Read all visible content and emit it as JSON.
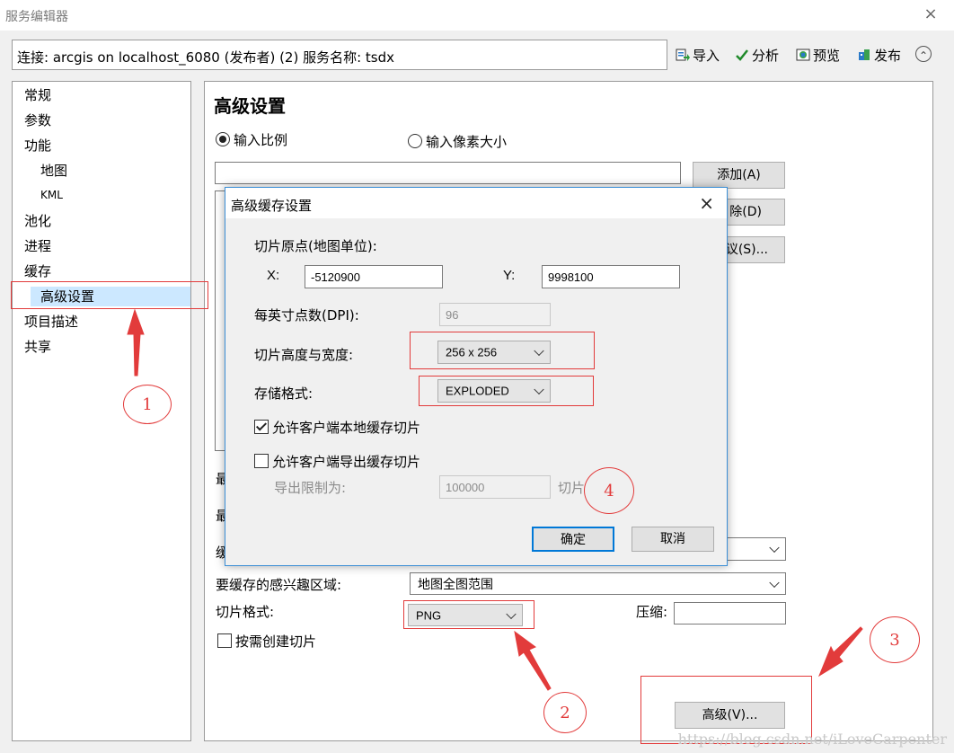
{
  "window": {
    "title": "服务编辑器",
    "close": "×"
  },
  "connection": {
    "text": "连接: arcgis on localhost_6080 (发布者) (2)   服务名称: tsdx"
  },
  "toolbar": {
    "import": "导入",
    "analyze": "分析",
    "preview": "预览",
    "publish": "发布",
    "collapse": "⌃"
  },
  "sidebar": {
    "items": [
      "常规",
      "参数",
      "功能",
      "地图",
      "KML",
      "池化",
      "进程",
      "缓存",
      "高级设置",
      "项目描述",
      "共享"
    ]
  },
  "main": {
    "heading": "高级设置",
    "radio_scale": "输入比例",
    "radio_pixel": "输入像素大小",
    "add_btn": "添加(A)",
    "delete_btn": "除(D)",
    "suggest_btn": "议(S)...",
    "partial_label_1": "最",
    "partial_label_2": "最",
    "partial_label_3": "缓",
    "roi_label": "要缓存的感兴趣区域:",
    "roi_value": "地图全图范围",
    "tile_format_label": "切片格式:",
    "tile_format_value": "PNG",
    "compress_label": "压缩:",
    "on_demand": "按需创建切片",
    "advanced_btn": "高级(V)..."
  },
  "dialog": {
    "title": "高级缓存设置",
    "close": "×",
    "origin_label": "切片原点(地图单位):",
    "x_label": "X:",
    "x_value": "-5120900",
    "y_label": "Y:",
    "y_value": "9998100",
    "dpi_label": "每英寸点数(DPI):",
    "dpi_value": "96",
    "size_label": "切片高度与宽度:",
    "size_value": "256 x 256",
    "storage_label": "存储格式:",
    "storage_value": "EXPLODED",
    "allow_local": "允许客户端本地缓存切片",
    "allow_export": "允许客户端导出缓存切片",
    "export_limit_label": "导出限制为:",
    "export_limit_value": "100000",
    "export_limit_unit": "切片",
    "ok": "确定",
    "cancel": "取消"
  },
  "annotations": [
    "1",
    "2",
    "3",
    "4"
  ],
  "watermark": "https://blog.csdn.net/iLoveCarpenter",
  "colors": {
    "annotation": "#e23b3b",
    "selection": "#cce8ff",
    "dialog_border": "#3c8fd6"
  }
}
